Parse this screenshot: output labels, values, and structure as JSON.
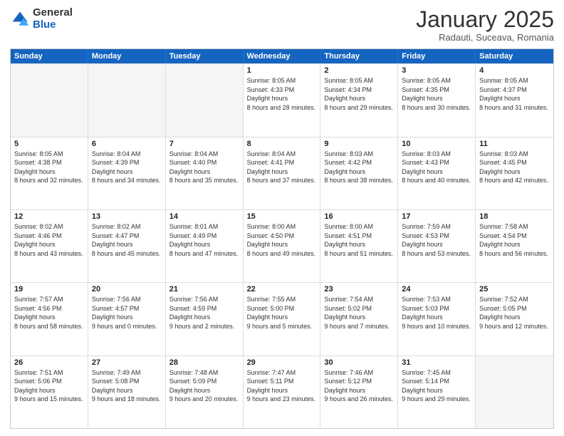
{
  "logo": {
    "general": "General",
    "blue": "Blue"
  },
  "header": {
    "month": "January 2025",
    "location": "Radauti, Suceava, Romania"
  },
  "weekdays": [
    "Sunday",
    "Monday",
    "Tuesday",
    "Wednesday",
    "Thursday",
    "Friday",
    "Saturday"
  ],
  "weeks": [
    [
      {
        "day": "",
        "empty": true
      },
      {
        "day": "",
        "empty": true
      },
      {
        "day": "",
        "empty": true
      },
      {
        "day": "1",
        "sunrise": "8:05 AM",
        "sunset": "4:33 PM",
        "daylight": "8 hours and 28 minutes."
      },
      {
        "day": "2",
        "sunrise": "8:05 AM",
        "sunset": "4:34 PM",
        "daylight": "8 hours and 29 minutes."
      },
      {
        "day": "3",
        "sunrise": "8:05 AM",
        "sunset": "4:35 PM",
        "daylight": "8 hours and 30 minutes."
      },
      {
        "day": "4",
        "sunrise": "8:05 AM",
        "sunset": "4:37 PM",
        "daylight": "8 hours and 31 minutes."
      }
    ],
    [
      {
        "day": "5",
        "sunrise": "8:05 AM",
        "sunset": "4:38 PM",
        "daylight": "8 hours and 32 minutes."
      },
      {
        "day": "6",
        "sunrise": "8:04 AM",
        "sunset": "4:39 PM",
        "daylight": "8 hours and 34 minutes."
      },
      {
        "day": "7",
        "sunrise": "8:04 AM",
        "sunset": "4:40 PM",
        "daylight": "8 hours and 35 minutes."
      },
      {
        "day": "8",
        "sunrise": "8:04 AM",
        "sunset": "4:41 PM",
        "daylight": "8 hours and 37 minutes."
      },
      {
        "day": "9",
        "sunrise": "8:03 AM",
        "sunset": "4:42 PM",
        "daylight": "8 hours and 38 minutes."
      },
      {
        "day": "10",
        "sunrise": "8:03 AM",
        "sunset": "4:43 PM",
        "daylight": "8 hours and 40 minutes."
      },
      {
        "day": "11",
        "sunrise": "8:03 AM",
        "sunset": "4:45 PM",
        "daylight": "8 hours and 42 minutes."
      }
    ],
    [
      {
        "day": "12",
        "sunrise": "8:02 AM",
        "sunset": "4:46 PM",
        "daylight": "8 hours and 43 minutes."
      },
      {
        "day": "13",
        "sunrise": "8:02 AM",
        "sunset": "4:47 PM",
        "daylight": "8 hours and 45 minutes."
      },
      {
        "day": "14",
        "sunrise": "8:01 AM",
        "sunset": "4:49 PM",
        "daylight": "8 hours and 47 minutes."
      },
      {
        "day": "15",
        "sunrise": "8:00 AM",
        "sunset": "4:50 PM",
        "daylight": "8 hours and 49 minutes."
      },
      {
        "day": "16",
        "sunrise": "8:00 AM",
        "sunset": "4:51 PM",
        "daylight": "8 hours and 51 minutes."
      },
      {
        "day": "17",
        "sunrise": "7:59 AM",
        "sunset": "4:53 PM",
        "daylight": "8 hours and 53 minutes."
      },
      {
        "day": "18",
        "sunrise": "7:58 AM",
        "sunset": "4:54 PM",
        "daylight": "8 hours and 56 minutes."
      }
    ],
    [
      {
        "day": "19",
        "sunrise": "7:57 AM",
        "sunset": "4:56 PM",
        "daylight": "8 hours and 58 minutes."
      },
      {
        "day": "20",
        "sunrise": "7:56 AM",
        "sunset": "4:57 PM",
        "daylight": "9 hours and 0 minutes."
      },
      {
        "day": "21",
        "sunrise": "7:56 AM",
        "sunset": "4:59 PM",
        "daylight": "9 hours and 2 minutes."
      },
      {
        "day": "22",
        "sunrise": "7:55 AM",
        "sunset": "5:00 PM",
        "daylight": "9 hours and 5 minutes."
      },
      {
        "day": "23",
        "sunrise": "7:54 AM",
        "sunset": "5:02 PM",
        "daylight": "9 hours and 7 minutes."
      },
      {
        "day": "24",
        "sunrise": "7:53 AM",
        "sunset": "5:03 PM",
        "daylight": "9 hours and 10 minutes."
      },
      {
        "day": "25",
        "sunrise": "7:52 AM",
        "sunset": "5:05 PM",
        "daylight": "9 hours and 12 minutes."
      }
    ],
    [
      {
        "day": "26",
        "sunrise": "7:51 AM",
        "sunset": "5:06 PM",
        "daylight": "9 hours and 15 minutes."
      },
      {
        "day": "27",
        "sunrise": "7:49 AM",
        "sunset": "5:08 PM",
        "daylight": "9 hours and 18 minutes."
      },
      {
        "day": "28",
        "sunrise": "7:48 AM",
        "sunset": "5:09 PM",
        "daylight": "9 hours and 20 minutes."
      },
      {
        "day": "29",
        "sunrise": "7:47 AM",
        "sunset": "5:11 PM",
        "daylight": "9 hours and 23 minutes."
      },
      {
        "day": "30",
        "sunrise": "7:46 AM",
        "sunset": "5:12 PM",
        "daylight": "9 hours and 26 minutes."
      },
      {
        "day": "31",
        "sunrise": "7:45 AM",
        "sunset": "5:14 PM",
        "daylight": "9 hours and 29 minutes."
      },
      {
        "day": "",
        "empty": true
      }
    ]
  ],
  "labels": {
    "sunrise_prefix": "Sunrise: ",
    "sunset_prefix": "Sunset: ",
    "daylight_prefix": "Daylight: "
  }
}
